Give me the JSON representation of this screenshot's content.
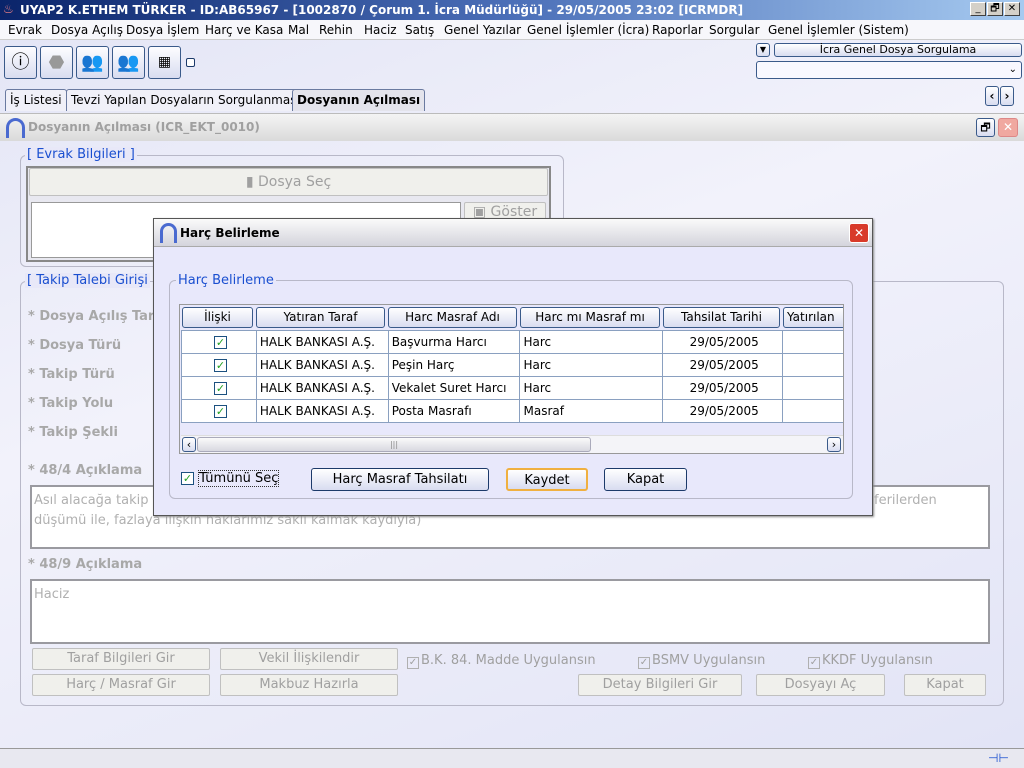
{
  "window": {
    "title": "UYAP2   K.ETHEM TÜRKER - ID:AB65967 - [1002870 / Çorum 1. İcra Müdürlüğü] - 29/05/2005 23:02 [ICRMDR]",
    "minimize": "_",
    "restore": "🗗",
    "close": "✕"
  },
  "menu": [
    "Evrak",
    "Dosya Açılış",
    "Dosya İşlem",
    "Harç ve Kasa",
    "Mal",
    "Rehin",
    "Haciz",
    "Satış",
    "Genel Yazılar",
    "Genel İşlemler (İcra)",
    "Raporlar",
    "Sorgular",
    "Genel İşlemler (Sistem)"
  ],
  "toolbar": {
    "icons": [
      "info-icon",
      "cancel-icon",
      "users-icon",
      "persons-icon",
      "calculator-icon"
    ],
    "quick_query_label": "İcra Genel Dosya Sorgulama",
    "quick_combo_value": ""
  },
  "tabs": [
    {
      "label": "İş Listesi"
    },
    {
      "label": "Tevzi Yapılan Dosyaların Sorgulanması"
    },
    {
      "label": "Dosyanın Açılması",
      "active": true
    }
  ],
  "frame": {
    "title": "Dosyanın Açılması (ICR_EKT_0010)"
  },
  "evrak": {
    "legend": "[ Evrak Bilgileri ]",
    "select_button": "Dosya Seç",
    "show_button": "Göster"
  },
  "takip": {
    "legend": "[ Takip Talebi Girişi",
    "fields": [
      "* Dosya Açılış Tari",
      "* Dosya Türü",
      "* Takip Türü",
      "* Takip Yolu",
      "* Takip Şekli"
    ],
    "aciklama_484_label": "* 48/4 Açıklama",
    "aciklama_484_text_1": "Asıl alacağa takip t",
    "aciklama_484_text_1_end": "ferilerden",
    "aciklama_484_text_2": "düşümü ile, fazlaya ilişkin haklarımız saklı kalmak kaydıyla)",
    "aciklama_489_label": "* 48/9 Açıklama",
    "aciklama_489_text": "Haciz",
    "buttons": {
      "taraf": "Taraf Bilgileri Gir",
      "vekil": "Vekil İlişkilendir",
      "harc": "Harç / Masraf Gir",
      "makbuz": "Makbuz Hazırla",
      "detay": "Detay Bilgileri Gir",
      "dosya_ac": "Dosyayı Aç",
      "kapat": "Kapat"
    },
    "checkboxes": [
      {
        "label": "B.K. 84. Madde Uygulansın",
        "checked": true
      },
      {
        "label": "BSMV Uygulansın",
        "checked": true
      },
      {
        "label": "KKDF Uygulansın",
        "checked": true
      }
    ]
  },
  "dialog": {
    "title": "Harç Belirleme",
    "group_legend": "Harç Belirleme",
    "columns": [
      "İlişki",
      "Yatıran Taraf",
      "Harc Masraf Adı",
      "Harc mı Masraf mı",
      "Tahsilat Tarihi",
      "Yatırılan"
    ],
    "rows": [
      {
        "checked": true,
        "party": "HALK BANKASI A.Ş.",
        "name": "Başvurma Harcı",
        "type": "Harc",
        "date": "29/05/2005",
        "amount": ""
      },
      {
        "checked": true,
        "party": "HALK BANKASI A.Ş.",
        "name": "Peşin Harç",
        "type": "Harc",
        "date": "29/05/2005",
        "amount": ""
      },
      {
        "checked": true,
        "party": "HALK BANKASI A.Ş.",
        "name": "Vekalet Suret Harcı",
        "type": "Harc",
        "date": "29/05/2005",
        "amount": ""
      },
      {
        "checked": true,
        "party": "HALK BANKASI A.Ş.",
        "name": "Posta Masrafı",
        "type": "Masraf",
        "date": "29/05/2005",
        "amount": ""
      }
    ],
    "select_all_label": "Tümünü Seç",
    "select_all_checked": true,
    "buttons": {
      "tahsilat": "Harç Masraf Tahsilatı",
      "kaydet": "Kaydet",
      "kapat": "Kapat"
    }
  },
  "colors": {
    "title_bar": "#0a246a",
    "legend": "#1a4fd0",
    "check": "#21a121",
    "close_red": "#d83a2a"
  }
}
